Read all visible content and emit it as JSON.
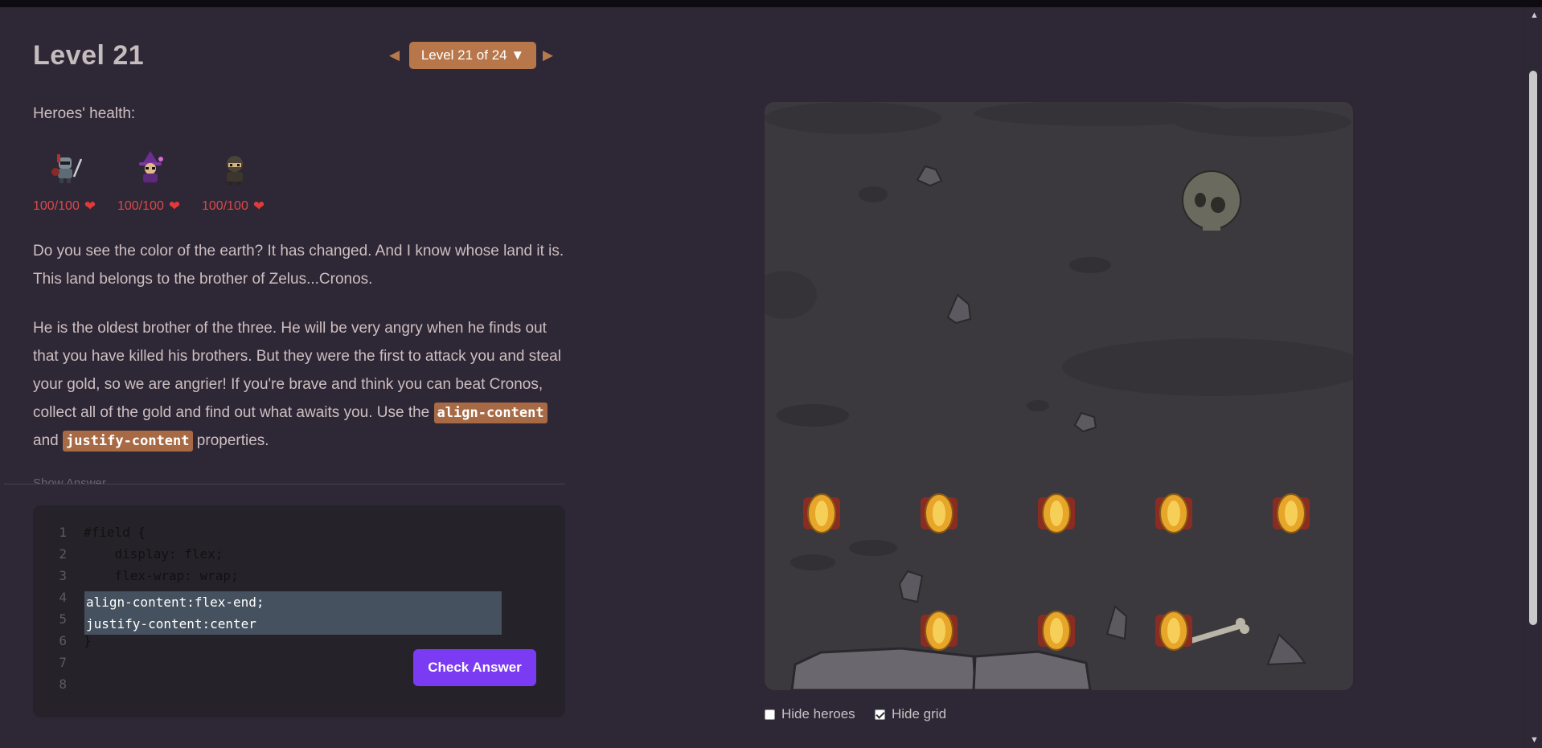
{
  "level": {
    "title": "Level 21",
    "selector_label": "Level 21 of 24 ▼",
    "prev_arrow": "◀",
    "next_arrow": "▶"
  },
  "health": {
    "label": "Heroes' health:",
    "heroes": [
      {
        "name_icon": "knight-icon",
        "hp": "100/100"
      },
      {
        "name_icon": "wizard-icon",
        "hp": "100/100"
      },
      {
        "name_icon": "rogue-icon",
        "hp": "100/100"
      }
    ],
    "heart": "❤"
  },
  "story": {
    "p1": "Do you see the color of the earth? It has changed. And I know whose land it is. This land belongs to the brother of Zelus...Cronos.",
    "p2_before": "He is the oldest brother of the three. He will be very angry when he finds out that you have killed his brothers. But they were the first to attack you and steal your gold, so we are angrier! If you're brave and think you can beat Cronos, collect all of the gold and find out what awaits you. Use the",
    "chip1": "align-content",
    "p2_and": "and",
    "chip2": "justify-content",
    "p2_after": "properties."
  },
  "show_answer": "Show Answer",
  "editor": {
    "line_numbers": [
      "1",
      "2",
      "3",
      "4",
      "5",
      "6",
      "7",
      "8"
    ],
    "lines": [
      "#field {",
      "    display: flex;",
      "    flex-wrap: wrap;",
      "",
      "",
      "}",
      "",
      ""
    ],
    "user_input": [
      "align-content:flex-end;",
      "justify-content:center"
    ],
    "check_label": "Check Answer"
  },
  "options": {
    "hide_heroes": {
      "label": "Hide heroes",
      "checked": false
    },
    "hide_grid": {
      "label": "Hide grid",
      "checked": true
    }
  },
  "colors": {
    "accent": "#b7774a",
    "button": "#7a3bf2",
    "health": "#d94a4a",
    "background": "#2e2735"
  }
}
